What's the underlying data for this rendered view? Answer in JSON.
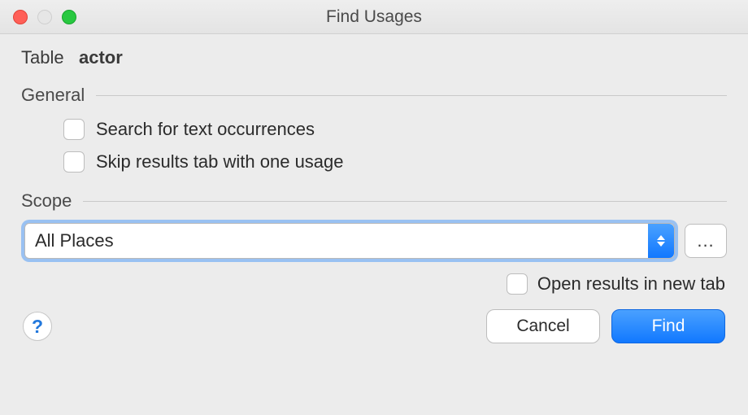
{
  "window": {
    "title": "Find Usages"
  },
  "subject": {
    "type_label": "Table",
    "name": "actor"
  },
  "sections": {
    "general": {
      "title": "General",
      "options": {
        "search_text_occurrences": {
          "label": "Search for text occurrences",
          "checked": false
        },
        "skip_results_one_usage": {
          "label": "Skip results tab with one usage",
          "checked": false
        }
      }
    },
    "scope": {
      "title": "Scope",
      "selected": "All Places",
      "more_label": "...",
      "open_new_tab": {
        "label": "Open results in new tab",
        "checked": false
      }
    }
  },
  "footer": {
    "help_label": "?",
    "cancel": "Cancel",
    "find": "Find"
  }
}
